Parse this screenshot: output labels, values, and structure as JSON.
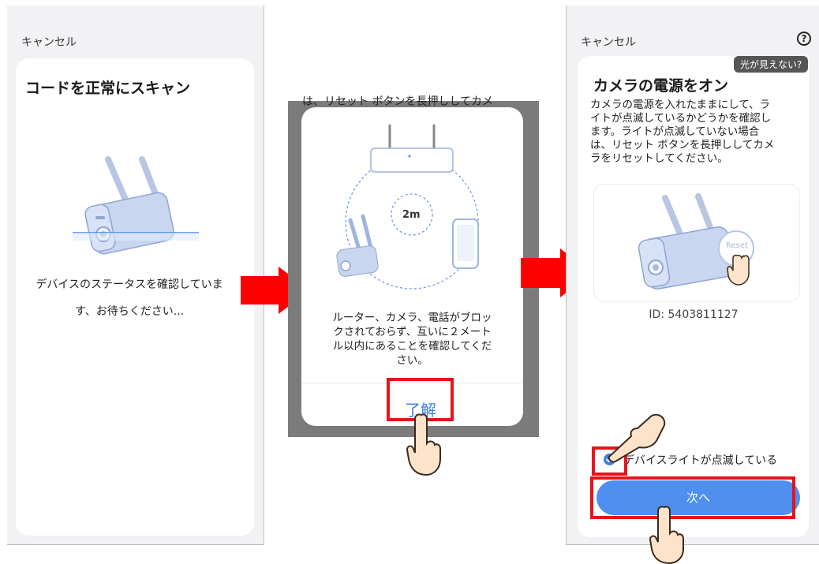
{
  "screen1": {
    "cancel_label": "キャンセル",
    "title": "コードを正常にスキャン",
    "status_line1": "デバイスのステータスを確認していま",
    "status_line2": "す、お待ちください..."
  },
  "screen2": {
    "background_text": "は、リセット ボタンを長押ししてカメ",
    "distance_label": "2m",
    "message_line1": "ルーター、カメラ、電話がブロッ",
    "message_line2": "クされておらず、互いに２メート",
    "message_line3": "ル以内にあることを確認してくだ",
    "message_line4": "さい。",
    "ok_label": "了解"
  },
  "screen3": {
    "cancel_label": "キャンセル",
    "help_icon_glyph": "?",
    "tooltip": "光が見えない?",
    "title": "カメラの電源をオン",
    "desc_line1": "カメラの電源を入れたままにして、ラ",
    "desc_line2": "イトが点滅しているかどうかを確認し",
    "desc_line3": "ます。ライトが点滅していない場合",
    "desc_line4": "は、リセット ボタンを長押ししてカメ",
    "desc_line5": "ラをリセットしてください。",
    "reset_label": "Reset",
    "device_id": "ID: 5403811127",
    "checkbox_label": "デバイスライトが点滅している",
    "next_label": "次へ"
  },
  "colors": {
    "accent": "#4e8ff0",
    "highlight_red": "#e8131a",
    "arrow_red": "#ff0000",
    "screen_bg": "#f2f2f5"
  }
}
